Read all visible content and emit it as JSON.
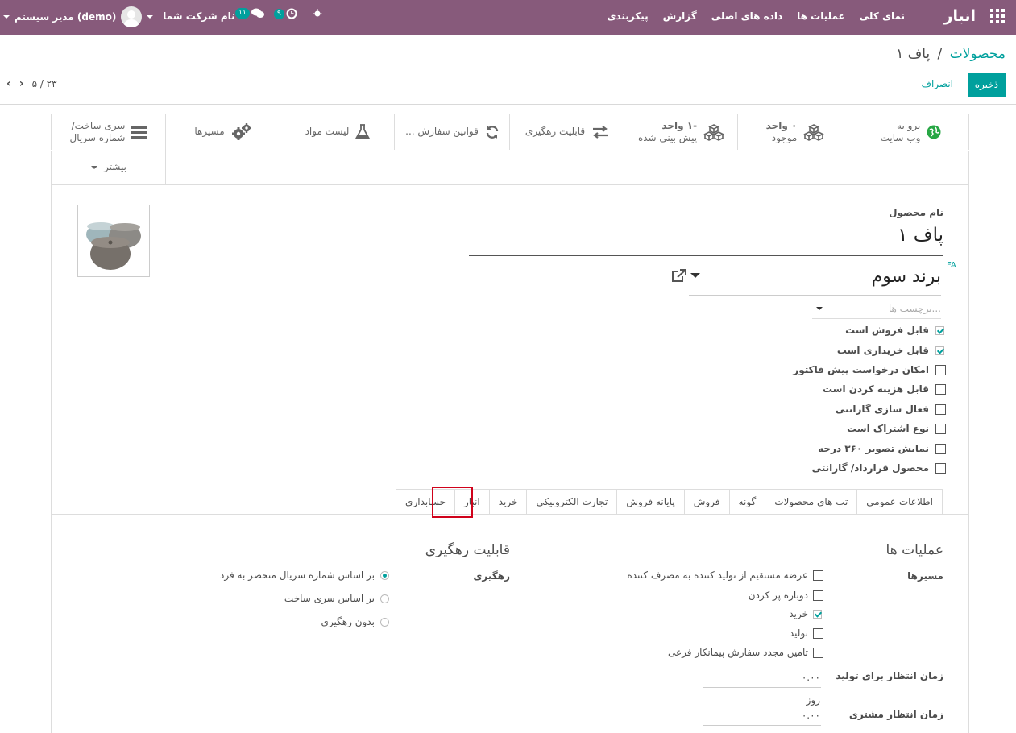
{
  "navbar": {
    "app_name": "انبار",
    "menu": [
      "نمای کلی",
      "عملیات ها",
      "داده های اصلی",
      "گزارش",
      "پیکربندی"
    ],
    "company": "نام شرکت شما",
    "user": "مدیر سیستم (demo)",
    "messages_count": "۱۱",
    "activities_count": "۹",
    "accent_color": "#875a7b"
  },
  "breadcrumb": {
    "parent": "محصولات",
    "separator": "/",
    "current": "پاف ۱"
  },
  "actions": {
    "save": "ذخیره",
    "discard": "انصراف"
  },
  "pager": {
    "value": "۵ / ۲۳"
  },
  "smart_buttons": {
    "website": "برو به\nوب سایت",
    "on_hand_value": "۰ واحد",
    "on_hand_label": "موجود",
    "forecast_value": "-۱ واحد",
    "forecast_label": "پیش بینی شده",
    "traceability": "قابلیت رهگیری",
    "reorder_rules": "قوانین سفارش ...",
    "bom": "لیست مواد",
    "routes": "مسیرها",
    "lots_line1": "سری ساخت/",
    "lots_line2": "شماره سریال",
    "more": "بیشتر"
  },
  "form": {
    "name_label": "نام محصول",
    "name_value": "پاف ۱",
    "lang_tag": "FA",
    "brand_value": "برند سوم",
    "tags_placeholder": "برچسب ها...",
    "checkboxes": [
      {
        "label": "قابل فروش است",
        "checked": true
      },
      {
        "label": "قابل خریداری است",
        "checked": true
      },
      {
        "label": "امکان درخواست پیش فاکتور",
        "checked": false
      },
      {
        "label": "قابل هزینه کردن است",
        "checked": false
      },
      {
        "label": "فعال سازی گارانتی",
        "checked": false
      },
      {
        "label": "نوع اشتراک است",
        "checked": false
      },
      {
        "label": "نمایش تصویر ۳۶۰ درجه",
        "checked": false
      },
      {
        "label": "محصول قرارداد/ گارانتی",
        "checked": false
      }
    ]
  },
  "tabs": [
    "اطلاعات عمومی",
    "تب های محصولات",
    "گونه",
    "فروش",
    "پایانه فروش",
    "تجارت الکترونیکی",
    "خرید",
    "انبار",
    "حسابداری"
  ],
  "active_tab": "انبار",
  "operations": {
    "title": "عملیات ها",
    "routes_label": "مسیرها",
    "routes": [
      {
        "label": "عرضه مستقیم از تولید کننده به مصرف کننده",
        "checked": false
      },
      {
        "label": "دوباره پر کردن",
        "checked": false
      },
      {
        "label": "خرید",
        "checked": true
      },
      {
        "label": "تولید",
        "checked": false
      },
      {
        "label": "تامین مجدد سفارش پیمانکار فرعی",
        "checked": false
      }
    ],
    "mfg_lead_label": "زمان انتظار برای تولید",
    "mfg_lead_value": "۰.۰۰",
    "days_unit": "روز",
    "customer_lead_label": "زمان انتظار مشتری",
    "customer_lead_value": "۰.۰۰"
  },
  "traceability": {
    "title": "قابلیت رهگیری",
    "label": "رهگیری",
    "options": [
      {
        "label": "بر اساس شماره سریال منحصر به فرد",
        "selected": true
      },
      {
        "label": "بر اساس سری ساخت",
        "selected": false
      },
      {
        "label": "بدون رهگیری",
        "selected": false
      }
    ]
  }
}
